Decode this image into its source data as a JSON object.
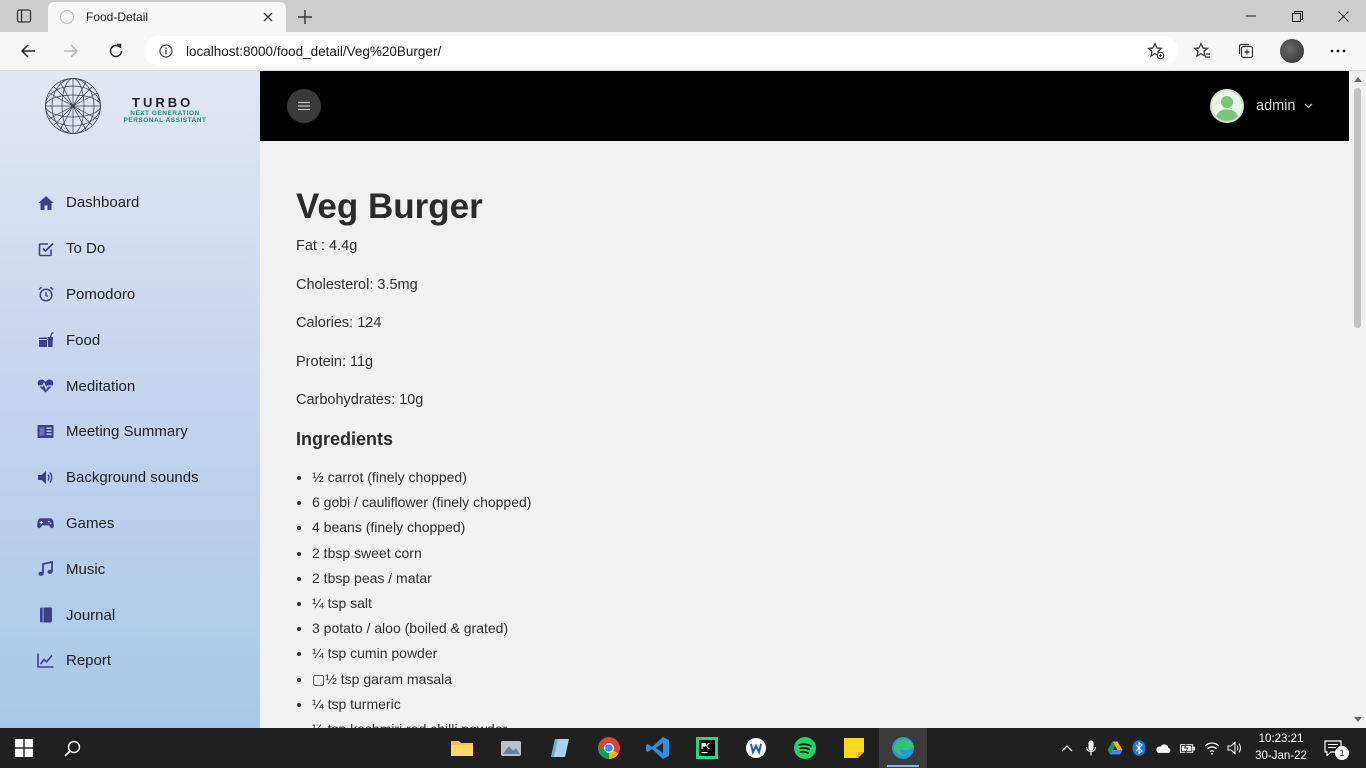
{
  "browser": {
    "tab_title": "Food-Detail",
    "url": "localhost:8000/food_detail/Veg%20Burger/",
    "icons": [
      "tab-actions-icon",
      "close-icon",
      "plus-icon",
      "minimize-icon",
      "restore-icon",
      "close-window-icon",
      "back-icon",
      "forward-icon",
      "refresh-icon",
      "info-icon",
      "add-favorite-icon",
      "favorites-icon",
      "collections-icon",
      "more-icon"
    ]
  },
  "sidebar": {
    "brand_name": "TURBO",
    "brand_tagline": "NEXT GENERATION PERSONAL ASSISTANT",
    "items": [
      {
        "label": "Dashboard",
        "icon": "home-icon"
      },
      {
        "label": "To Do",
        "icon": "checkbox-icon"
      },
      {
        "label": "Pomodoro",
        "icon": "alarm-icon"
      },
      {
        "label": "Food",
        "icon": "food-icon"
      },
      {
        "label": "Meditation",
        "icon": "heartbeat-icon"
      },
      {
        "label": "Meeting Summary",
        "icon": "book-open-icon"
      },
      {
        "label": "Background sounds",
        "icon": "volume-icon"
      },
      {
        "label": "Games",
        "icon": "gamepad-icon"
      },
      {
        "label": "Music",
        "icon": "music-icon"
      },
      {
        "label": "Journal",
        "icon": "journal-icon"
      },
      {
        "label": "Report",
        "icon": "chart-line-icon"
      }
    ],
    "accent_color": "#3d3f8f"
  },
  "topbar": {
    "username": "admin"
  },
  "food": {
    "title": "Veg Burger",
    "facts": {
      "fat": "Fat : 4.4g",
      "cholesterol": "Cholesterol: 3.5mg",
      "calories": "Calories: 124",
      "protein": "Protein: 11g",
      "carbohydrates": "Carbohydrates: 10g"
    },
    "ingredients_heading": "Ingredients",
    "ingredients": [
      "½ carrot (finely chopped)",
      "6 gobi / cauliflower (finely chopped)",
      "4 beans (finely chopped)",
      "2 tbsp sweet corn",
      "2 tbsp peas / matar",
      "¼ tsp salt",
      "3 potato / aloo (boiled & grated)",
      "¼ tsp cumin powder",
      "▢½ tsp garam masala",
      "¼ tsp turmeric",
      "½ tsp kashmiri red chilli powder"
    ]
  },
  "taskbar": {
    "clock_time": "10:23:21",
    "clock_date": "30-Jan-22",
    "notification_count": "1"
  }
}
